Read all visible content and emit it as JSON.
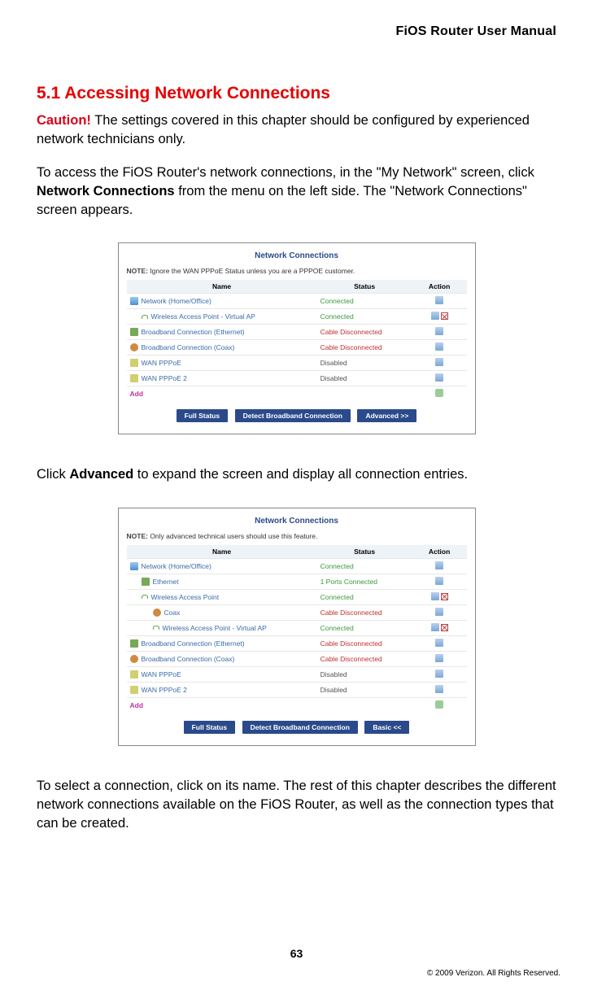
{
  "header": {
    "title": "FiOS Router User Manual"
  },
  "heading": "5.1  Accessing Network Connections",
  "caution_label": "Caution!",
  "caution_text": " The settings covered in this chapter should be configured by experienced network technicians only.",
  "para1_a": "To access the FiOS Router's network connections, in the \"My Network\" screen, click ",
  "para1_bold": "Network Connections",
  "para1_b": " from the menu on the left side. The \"Network Connections\" screen appears.",
  "para2_a": "Click ",
  "para2_bold": "Advanced",
  "para2_b": " to expand the screen and display all connection entries.",
  "para3": "To select a connection, click on its name. The rest of this chapter describes the different network connections available on the FiOS Router, as well as the connection types that can be created.",
  "page_number": "63",
  "copyright": "© 2009 Verizon. All Rights Reserved.",
  "shot_common": {
    "title": "Network Connections",
    "note_label": "NOTE:",
    "col_name": "Name",
    "col_status": "Status",
    "col_action": "Action",
    "add": "Add",
    "btn_full": "Full Status",
    "btn_detect": "Detect Broadband Connection"
  },
  "shot1": {
    "note_text": " Ignore the WAN PPPoE Status unless you are a PPPOE customer.",
    "btn_mode": "Advanced >>",
    "rows": [
      {
        "name": "Network (Home/Office)",
        "status": "Connected",
        "status_cls": "connected",
        "indent": 0,
        "icon": "net",
        "actions": [
          "edit"
        ]
      },
      {
        "name": "Wireless Access Point - Virtual AP",
        "status": "Connected",
        "status_cls": "connected",
        "indent": 1,
        "icon": "wifi",
        "actions": [
          "edit",
          "del"
        ]
      },
      {
        "name": "Broadband Connection (Ethernet)",
        "status": "Cable Disconnected",
        "status_cls": "disconnected",
        "indent": 0,
        "icon": "eth",
        "actions": [
          "edit"
        ]
      },
      {
        "name": "Broadband Connection (Coax)",
        "status": "Cable Disconnected",
        "status_cls": "disconnected",
        "indent": 0,
        "icon": "coax",
        "actions": [
          "edit"
        ]
      },
      {
        "name": "WAN PPPoE",
        "status": "Disabled",
        "status_cls": "disabled",
        "indent": 0,
        "icon": "wan",
        "actions": [
          "edit"
        ]
      },
      {
        "name": "WAN PPPoE 2",
        "status": "Disabled",
        "status_cls": "disabled",
        "indent": 0,
        "icon": "wan",
        "actions": [
          "edit"
        ]
      }
    ]
  },
  "shot2": {
    "note_text": " Only advanced technical users should use this feature.",
    "btn_mode": "Basic <<",
    "rows": [
      {
        "name": "Network (Home/Office)",
        "status": "Connected",
        "status_cls": "connected",
        "indent": 0,
        "icon": "net",
        "actions": [
          "edit"
        ]
      },
      {
        "name": "Ethernet",
        "status": "1 Ports Connected",
        "status_cls": "ports",
        "indent": 1,
        "icon": "eth",
        "actions": [
          "edit"
        ]
      },
      {
        "name": "Wireless Access Point",
        "status": "Connected",
        "status_cls": "connected",
        "indent": 1,
        "icon": "wifi",
        "actions": [
          "edit",
          "del"
        ]
      },
      {
        "name": "Coax",
        "status": "Cable Disconnected",
        "status_cls": "disconnected",
        "indent": 2,
        "icon": "coax",
        "actions": [
          "edit"
        ]
      },
      {
        "name": "Wireless Access Point - Virtual AP",
        "status": "Connected",
        "status_cls": "connected",
        "indent": 2,
        "icon": "wifi",
        "actions": [
          "edit",
          "del"
        ]
      },
      {
        "name": "Broadband Connection (Ethernet)",
        "status": "Cable Disconnected",
        "status_cls": "disconnected",
        "indent": 0,
        "icon": "eth",
        "actions": [
          "edit"
        ]
      },
      {
        "name": "Broadband Connection (Coax)",
        "status": "Cable Disconnected",
        "status_cls": "disconnected",
        "indent": 0,
        "icon": "coax",
        "actions": [
          "edit"
        ]
      },
      {
        "name": "WAN PPPoE",
        "status": "Disabled",
        "status_cls": "disabled",
        "indent": 0,
        "icon": "wan",
        "actions": [
          "edit"
        ]
      },
      {
        "name": "WAN PPPoE 2",
        "status": "Disabled",
        "status_cls": "disabled",
        "indent": 0,
        "icon": "wan",
        "actions": [
          "edit"
        ]
      }
    ]
  }
}
